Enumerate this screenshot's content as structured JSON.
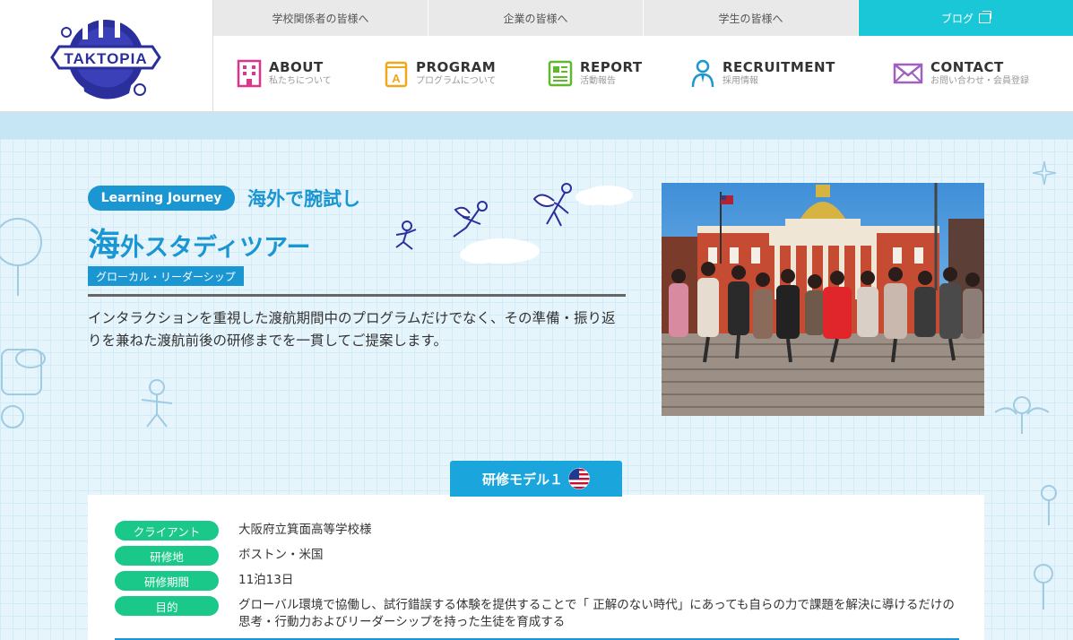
{
  "header": {
    "logo_text": "TAKTOPIA",
    "topbar": [
      {
        "label": "学校関係者の皆様へ"
      },
      {
        "label": "企業の皆様へ"
      },
      {
        "label": "学生の皆様へ"
      }
    ],
    "blog_label": "ブログ",
    "nav": [
      {
        "en": "ABOUT",
        "ja": "私たちについて",
        "icon": "building-icon"
      },
      {
        "en": "PROGRAM",
        "ja": "プログラムについて",
        "icon": "book-icon"
      },
      {
        "en": "REPORT",
        "ja": "活動報告",
        "icon": "report-icon"
      },
      {
        "en": "RECRUITMENT",
        "ja": "採用情報",
        "icon": "person-icon"
      },
      {
        "en": "CONTACT",
        "ja": "お問い合わせ・会員登録",
        "icon": "mail-icon"
      }
    ]
  },
  "hero": {
    "pill": "Learning Journey",
    "subtitle": "海外で腕試し",
    "title_big": "海",
    "title_rest": "外スタディツアー",
    "tag": "グローカル・リーダーシップ",
    "description": "インタラクションを重視した渡航期間中のプログラムだけでなく、その準備・振り返りを兼ねた渡航前後の研修までを一貫してご提案します。"
  },
  "model": {
    "tab_label": "研修モデル１",
    "flag_icon": "us-flag-icon",
    "rows": [
      {
        "label": "クライアント",
        "value": "大阪府立箕面高等学校様"
      },
      {
        "label": "研修地",
        "value": "ボストン・米国"
      },
      {
        "label": "研修期間",
        "value": "11泊13日"
      },
      {
        "label": "目的",
        "value": "グローバル環境で協働し、試行錯誤する体験を提供することで「 正解のない時代」にあっても自らの力で課題を解決に導けるだけの思考・行動力およびリーダーシップを持った生徒を育成する"
      }
    ]
  },
  "colors": {
    "accent": "#1a96d3",
    "blog": "#1ac7d6",
    "label_green": "#1ac98a"
  }
}
